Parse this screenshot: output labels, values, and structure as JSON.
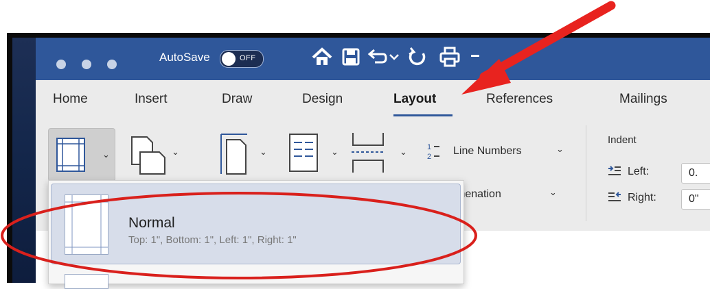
{
  "titlebar": {
    "autosave_label": "AutoSave",
    "autosave_state": "OFF"
  },
  "tabs": [
    {
      "label": "Home"
    },
    {
      "label": "Insert"
    },
    {
      "label": "Draw"
    },
    {
      "label": "Design"
    },
    {
      "label": "Layout",
      "active": true
    },
    {
      "label": "References"
    },
    {
      "label": "Mailings"
    }
  ],
  "ribbon": {
    "line_numbers_label": "Line Numbers",
    "hyphenation_label": "Hyphenation",
    "indent_heading": "Indent",
    "indent_left_label": "Left:",
    "indent_left_value": "0.",
    "indent_right_label": "Right:",
    "indent_right_value": "0\""
  },
  "margins_dropdown": {
    "items": [
      {
        "title": "Normal",
        "description": "Top: 1\", Bottom: 1\", Left: 1\", Right: 1\""
      }
    ]
  },
  "annotation_colors": {
    "arrow": "#e8231f",
    "ellipse": "#d9201c"
  }
}
